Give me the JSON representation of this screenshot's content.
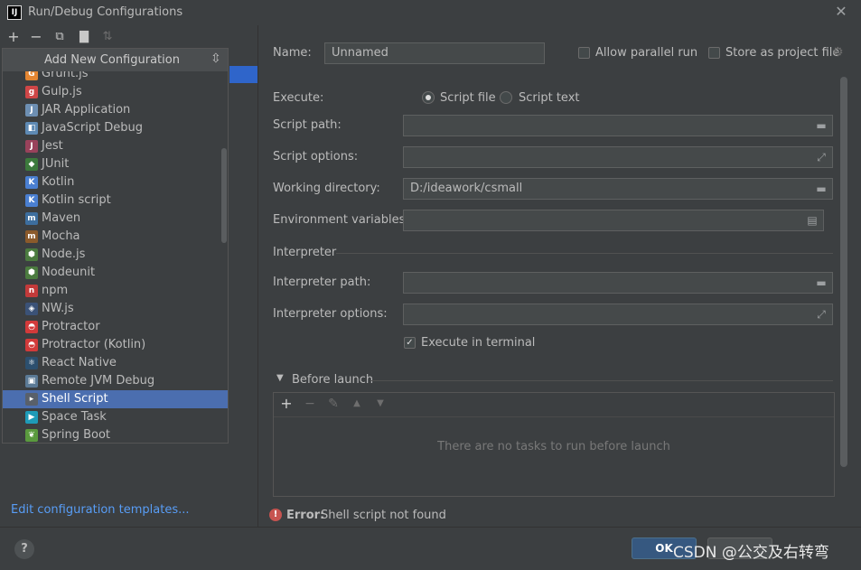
{
  "window": {
    "title": "Run/Debug Configurations",
    "logo_text": "IJ"
  },
  "toolbar": {
    "add_icon": "plus-icon",
    "remove_icon": "minus-icon",
    "copy_icon": "copy-icon",
    "folder_icon": "new-folder-icon",
    "sort_icon": "sort-icon"
  },
  "popup": {
    "title": "Add New Configuration",
    "items": [
      {
        "label": "Grunt.js",
        "icon": "grunt-icon",
        "color": "#e48632",
        "glyph": "G"
      },
      {
        "label": "Gulp.js",
        "icon": "gulp-icon",
        "color": "#cf4647",
        "glyph": "g"
      },
      {
        "label": "JAR Application",
        "icon": "jar-icon",
        "color": "#6d8fb3",
        "glyph": "J"
      },
      {
        "label": "JavaScript Debug",
        "icon": "js-debug-icon",
        "color": "#5e8ab4",
        "glyph": "◧"
      },
      {
        "label": "Jest",
        "icon": "jest-icon",
        "color": "#99425b",
        "glyph": "J"
      },
      {
        "label": "JUnit",
        "icon": "junit-icon",
        "color": "#3c7a3c",
        "glyph": "◆"
      },
      {
        "label": "Kotlin",
        "icon": "kotlin-icon",
        "color": "#4a7fd1",
        "glyph": "K"
      },
      {
        "label": "Kotlin script",
        "icon": "kotlin-script-icon",
        "color": "#4a7fd1",
        "glyph": "K"
      },
      {
        "label": "Maven",
        "icon": "maven-icon",
        "color": "#3d6e9e",
        "glyph": "m"
      },
      {
        "label": "Mocha",
        "icon": "mocha-icon",
        "color": "#8b5a2b",
        "glyph": "m"
      },
      {
        "label": "Node.js",
        "icon": "nodejs-icon",
        "color": "#4b7b3f",
        "glyph": "⬢"
      },
      {
        "label": "Nodeunit",
        "icon": "nodeunit-icon",
        "color": "#4b7b3f",
        "glyph": "⬢"
      },
      {
        "label": "npm",
        "icon": "npm-icon",
        "color": "#c23a3a",
        "glyph": "n"
      },
      {
        "label": "NW.js",
        "icon": "nwjs-icon",
        "color": "#3b5277",
        "glyph": "◈"
      },
      {
        "label": "Protractor",
        "icon": "protractor-icon",
        "color": "#d23a3a",
        "glyph": "◓"
      },
      {
        "label": "Protractor (Kotlin)",
        "icon": "protractor-kotlin-icon",
        "color": "#d23a3a",
        "glyph": "◓"
      },
      {
        "label": "React Native",
        "icon": "react-icon",
        "color": "#2c4f6e",
        "glyph": "⚛"
      },
      {
        "label": "Remote JVM Debug",
        "icon": "remote-debug-icon",
        "color": "#5b7a96",
        "glyph": "▣"
      },
      {
        "label": "Shell Script",
        "icon": "shell-icon",
        "color": "#59606a",
        "glyph": "▸"
      },
      {
        "label": "Space Task",
        "icon": "space-icon",
        "color": "#1e9bb8",
        "glyph": "▶"
      },
      {
        "label": "Spring Boot",
        "icon": "spring-icon",
        "color": "#5a9a3e",
        "glyph": "❦"
      }
    ],
    "selected_index": 18
  },
  "left": {
    "edit_templates": "Edit configuration templates..."
  },
  "form": {
    "name_label": "Name:",
    "name_value": "Unnamed",
    "allow_parallel": "Allow parallel run",
    "store_project": "Store as project file",
    "execute_label": "Execute:",
    "script_file": "Script file",
    "script_text": "Script text",
    "script_path_label": "Script path:",
    "script_options_label": "Script options:",
    "working_dir_label": "Working directory:",
    "working_dir_value": "D:/ideawork/csmall",
    "env_vars_label": "Environment variables:",
    "interpreter_section": "Interpreter",
    "interpreter_path_label": "Interpreter path:",
    "interpreter_options_label": "Interpreter options:",
    "execute_in_terminal": "Execute in terminal",
    "before_launch": "Before launch",
    "no_tasks": "There are no tasks to run before launch"
  },
  "error": {
    "prefix": "Error:",
    "message": "Shell script not found"
  },
  "footer": {
    "help": "?",
    "ok": "OK",
    "watermark": "CSDN @公交及右转弯"
  }
}
